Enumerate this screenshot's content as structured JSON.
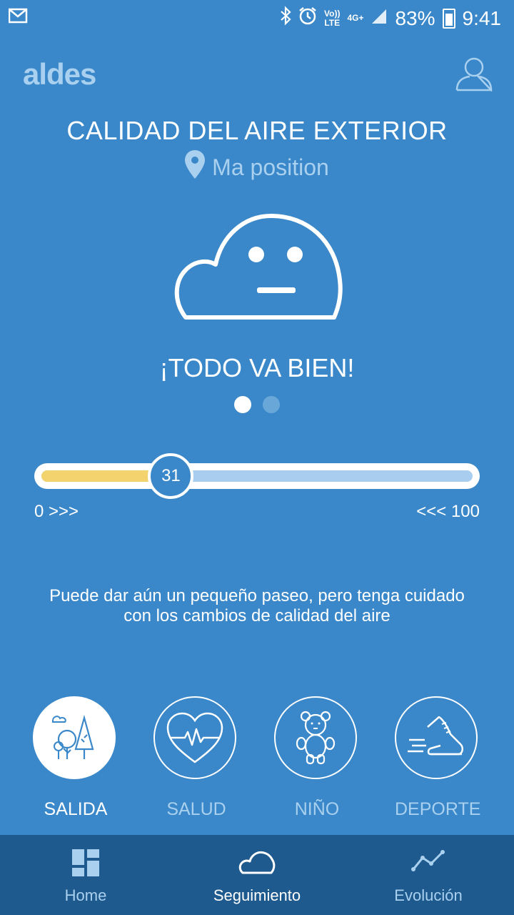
{
  "status_bar": {
    "mail_icon": "mail-icon",
    "bluetooth_icon": "bluetooth-icon",
    "alarm_icon": "alarm-icon",
    "volte_line1": "Vo))",
    "volte_line2": "LTE",
    "network": "4G+",
    "battery_percent": "83%",
    "time": "9:41"
  },
  "header": {
    "logo": "aldes",
    "profile_icon": "user-icon"
  },
  "title": "CALIDAD DEL AIRE EXTERIOR",
  "location": {
    "icon": "location-pin-icon",
    "label": "Ma position"
  },
  "status_message": "¡TODO VA BIEN!",
  "pager": {
    "total": 2,
    "active_index": 0
  },
  "gauge": {
    "value": 31,
    "value_label": "31",
    "min_label": "0 >>>",
    "max_label": "<<< 100",
    "fill_color": "#f2d36d",
    "track_color": "#a8cdee"
  },
  "advice_line1": "Puede dar aún un pequeño paseo, pero tenga cuidado",
  "advice_line2": "con los cambios de calidad del aire",
  "categories": [
    {
      "label": "SALIDA",
      "icon": "outdoor-trees-icon",
      "selected": true
    },
    {
      "label": "SALUD",
      "icon": "heart-pulse-icon",
      "selected": false
    },
    {
      "label": "NIÑO",
      "icon": "teddy-bear-icon",
      "selected": false
    },
    {
      "label": "DEPORTE",
      "icon": "running-shoe-icon",
      "selected": false
    }
  ],
  "bottom_nav": [
    {
      "label": "Home",
      "icon": "dashboard-icon",
      "active": false
    },
    {
      "label": "Seguimiento",
      "icon": "cloud-icon",
      "active": true
    },
    {
      "label": "Evolución",
      "icon": "trend-line-icon",
      "active": false
    }
  ],
  "colors": {
    "background": "#3a88c9",
    "nav_background": "#1e5a8e",
    "accent_light": "#a9d0ef"
  }
}
